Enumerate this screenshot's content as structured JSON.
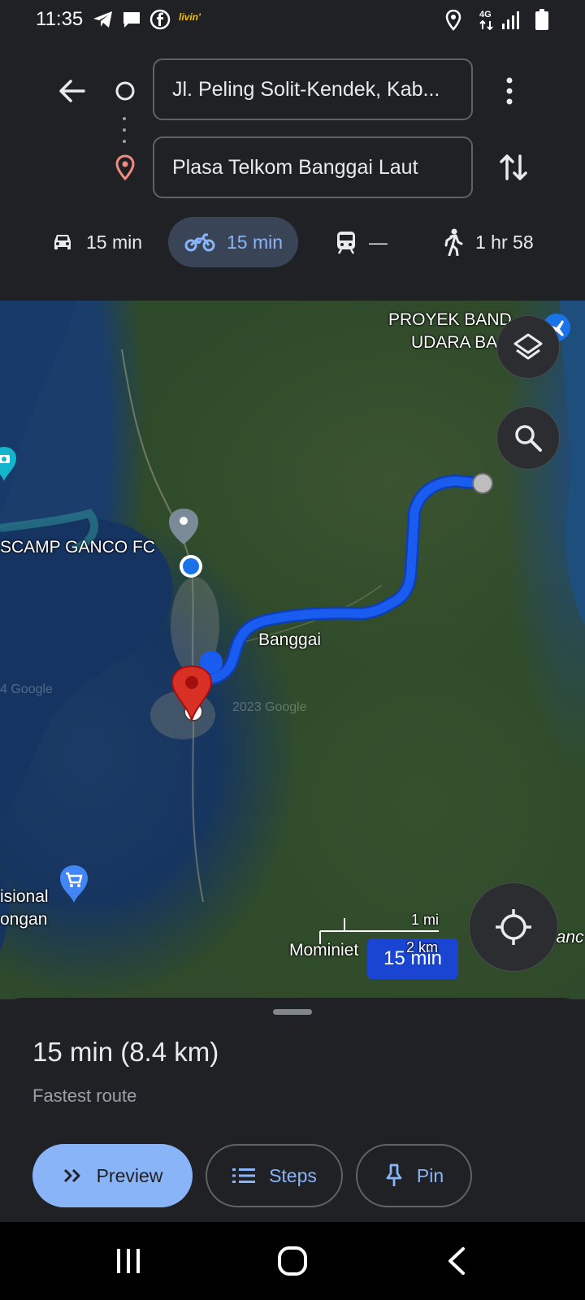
{
  "status_bar": {
    "time": "11:35",
    "left_icons": [
      "telegram-icon",
      "message-icon",
      "facebook-icon",
      "livin-icon"
    ],
    "livin_label": "livin'",
    "network_label": "4G",
    "right_icons": [
      "location-icon",
      "network-4g-icon",
      "signal-icon",
      "battery-icon"
    ]
  },
  "directions": {
    "origin": "Jl. Peling Solit-Kendek, Kab...",
    "destination": "Plasa Telkom Banggai Laut"
  },
  "travel_modes": [
    {
      "mode": "drive",
      "icon": "car-icon",
      "label": "15 min",
      "active": false
    },
    {
      "mode": "motorcycle",
      "icon": "motorcycle-icon",
      "label": "15 min",
      "active": true
    },
    {
      "mode": "transit",
      "icon": "train-icon",
      "label": "—",
      "active": false
    },
    {
      "mode": "walk",
      "icon": "walk-icon",
      "label": "1 hr 58",
      "active": false
    }
  ],
  "map": {
    "labels": {
      "airport_line1": "PROYEK BAND",
      "airport_line2": "UDARA BA",
      "ganco": "SCAMP GANCO FC",
      "banggai": "Banggai",
      "store_line1": "isional",
      "store_line2": "ongan",
      "mominiet": "Mominiet",
      "partial_right": "lanc"
    },
    "watermarks": [
      "4 Google",
      "2023 Google"
    ],
    "route_time": "15 min",
    "scale": {
      "imperial": "1 mi",
      "metric": "2 km"
    },
    "colors": {
      "route": "#1a5cf0",
      "destination_pin": "#d93025",
      "badge": "#1a45d2"
    }
  },
  "sheet": {
    "summary": "15 min (8.4 km)",
    "subtitle": "Fastest route",
    "buttons": {
      "preview": "Preview",
      "steps": "Steps",
      "pin": "Pin"
    }
  },
  "colors": {
    "accent": "#8ab4f8",
    "background": "#202124",
    "active_mode_bg": "#394457"
  }
}
